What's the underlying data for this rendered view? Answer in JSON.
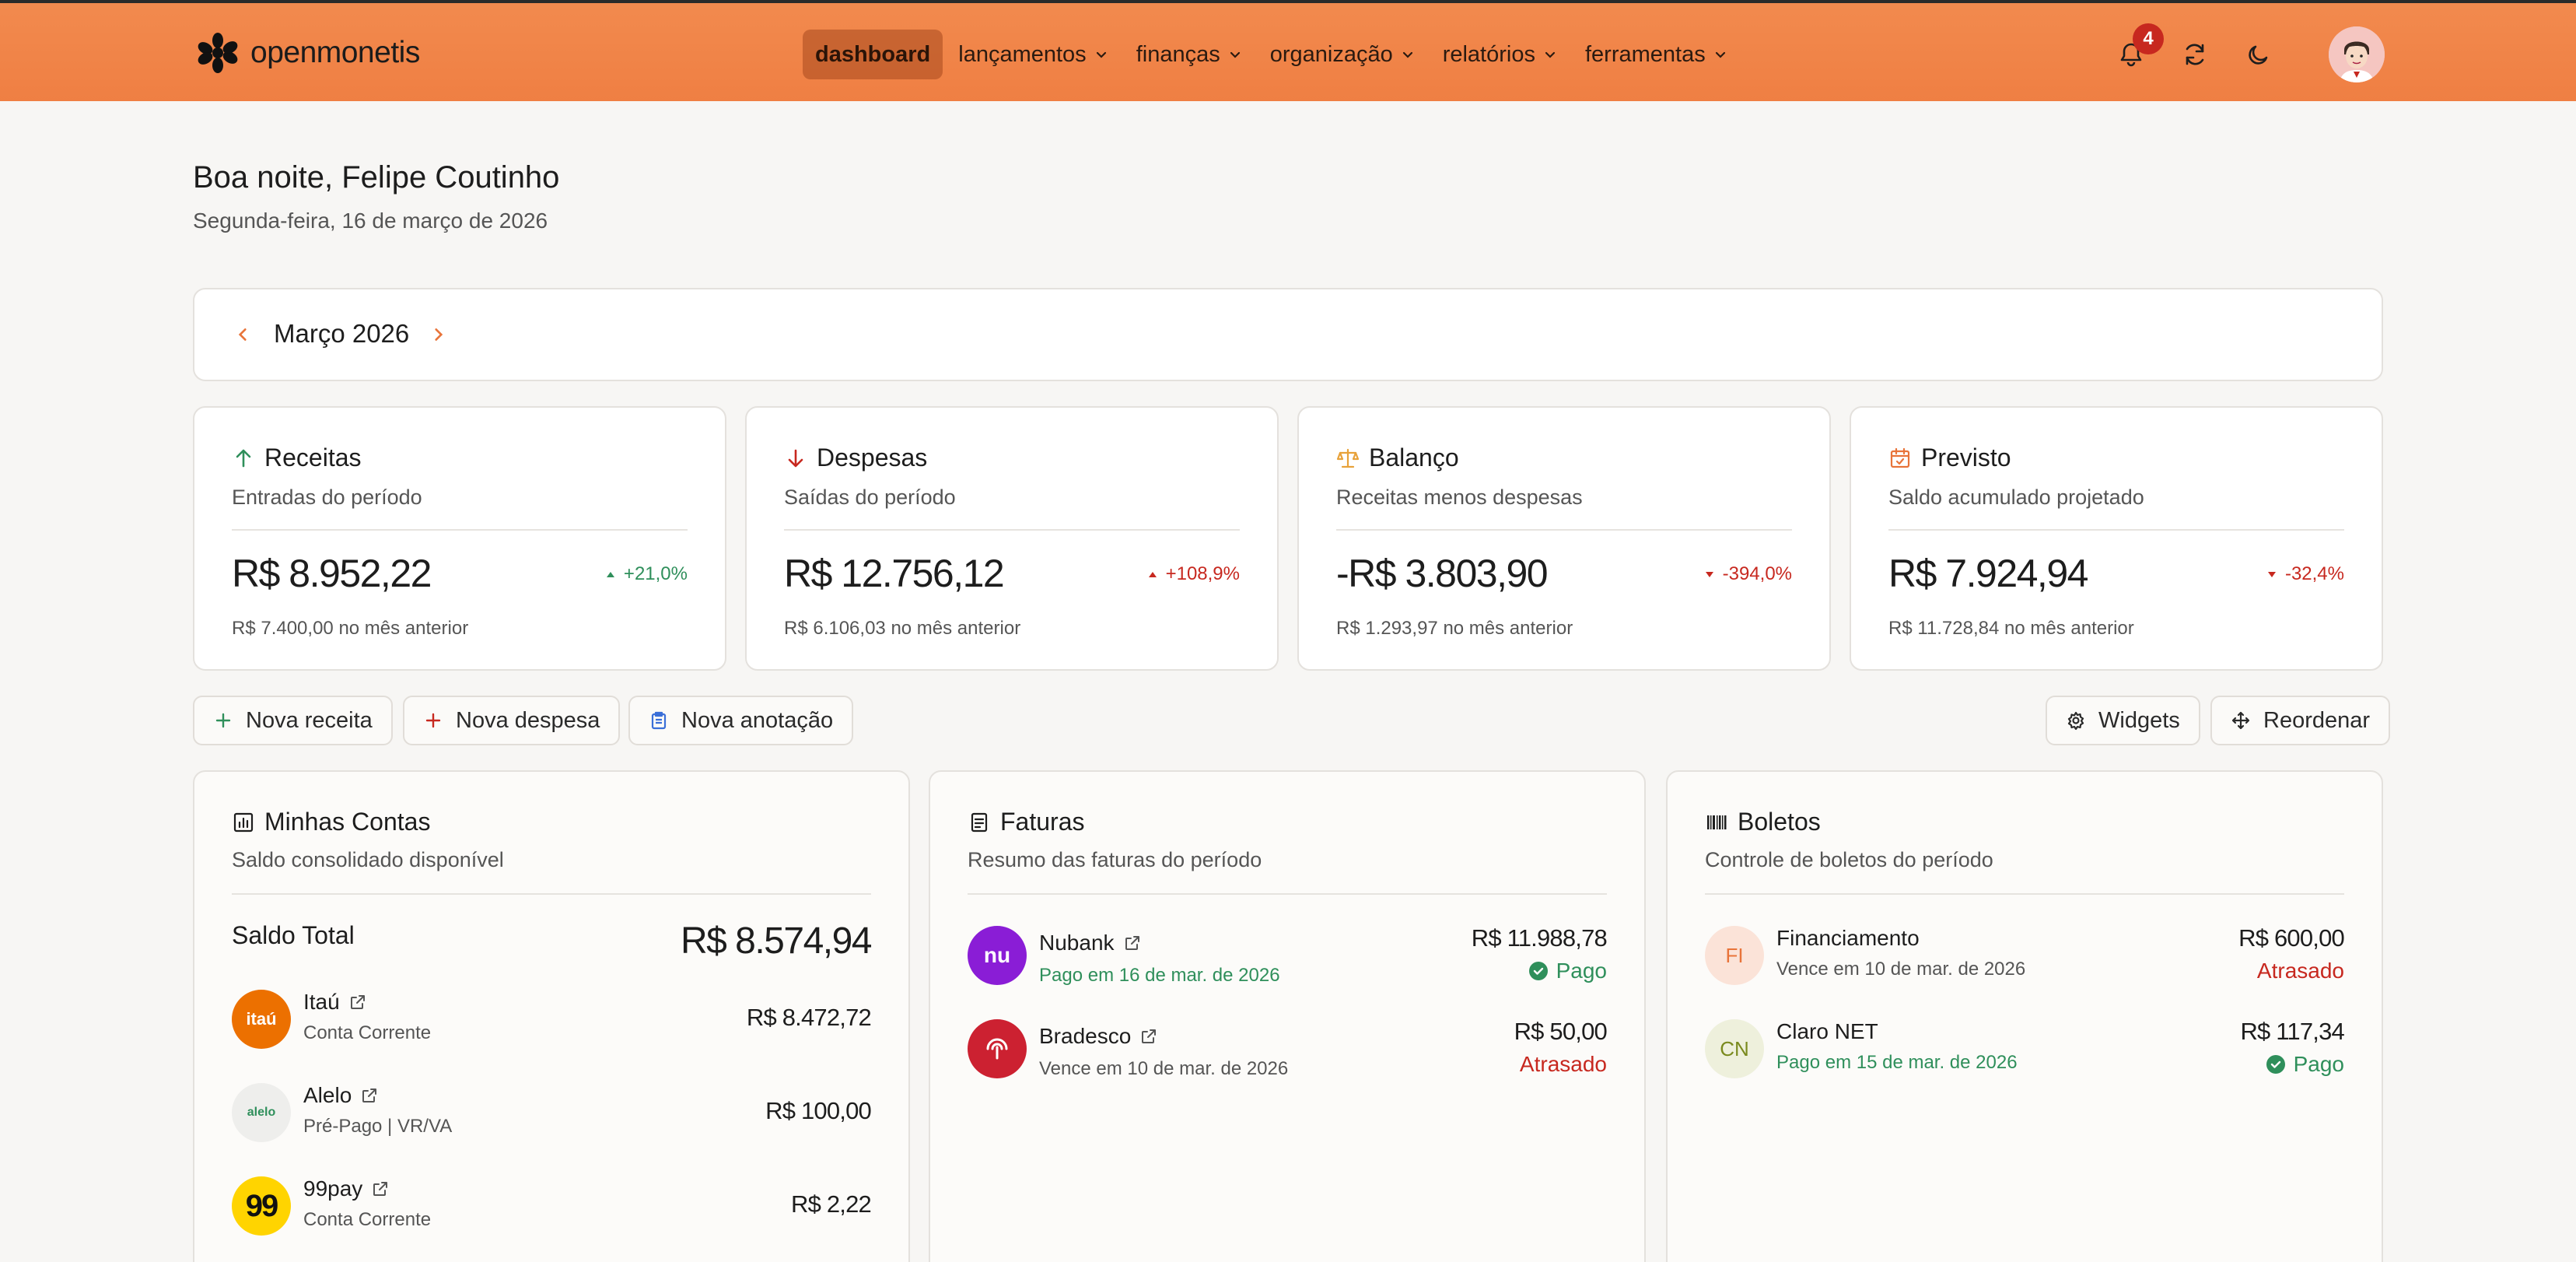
{
  "brand": {
    "name": "openmonetis"
  },
  "nav": {
    "items": [
      {
        "label": "dashboard",
        "active": true,
        "dropdown": false
      },
      {
        "label": "lançamentos",
        "active": false,
        "dropdown": true
      },
      {
        "label": "finanças",
        "active": false,
        "dropdown": true
      },
      {
        "label": "organização",
        "active": false,
        "dropdown": true
      },
      {
        "label": "relatórios",
        "active": false,
        "dropdown": true
      },
      {
        "label": "ferramentas",
        "active": false,
        "dropdown": true
      }
    ],
    "notifications_count": "4",
    "icons": [
      "bell-icon",
      "sync-icon",
      "moon-icon",
      "avatar"
    ]
  },
  "greeting": {
    "title": "Boa noite, Felipe Coutinho",
    "date": "Segunda-feira, 16 de março de 2026"
  },
  "period": {
    "label": "Março 2026"
  },
  "stats": [
    {
      "title": "Receitas",
      "subtitle": "Entradas do período",
      "value": "R$ 8.952,22",
      "change": "+21,0%",
      "previous": "R$ 7.400,00 no mês anterior",
      "icon": "arrow-up-icon",
      "trend": "up",
      "color": "#2f8f5b"
    },
    {
      "title": "Despesas",
      "subtitle": "Saídas do período",
      "value": "R$ 12.756,12",
      "change": "+108,9%",
      "previous": "R$ 6.106,03 no mês anterior",
      "icon": "arrow-down-icon",
      "trend": "up",
      "color": "#c7281f"
    },
    {
      "title": "Balanço",
      "subtitle": "Receitas menos despesas",
      "value": "-R$ 3.803,90",
      "change": "-394,0%",
      "previous": "R$ 1.293,97 no mês anterior",
      "icon": "scale-icon",
      "trend": "down",
      "color": "#c7281f"
    },
    {
      "title": "Previsto",
      "subtitle": "Saldo acumulado projetado",
      "value": "R$ 7.924,94",
      "change": "-32,4%",
      "previous": "R$ 11.728,84 no mês anterior",
      "icon": "calendar-check-icon",
      "trend": "down",
      "color": "#c7281f"
    }
  ],
  "actions": {
    "new_income": "Nova receita",
    "new_expense": "Nova despesa",
    "new_note": "Nova anotação",
    "widgets": "Widgets",
    "reorder": "Reordenar"
  },
  "accounts": {
    "title": "Minhas Contas",
    "subtitle": "Saldo consolidado disponível",
    "total_label": "Saldo Total",
    "total_value": "R$ 8.574,94",
    "items": [
      {
        "name": "Itaú",
        "type": "Conta Corrente",
        "amount": "R$ 8.472,72",
        "logo_text": "itaú"
      },
      {
        "name": "Alelo",
        "type": "Pré-Pago | VR/VA",
        "amount": "R$ 100,00",
        "logo_text": "alelo"
      },
      {
        "name": "99pay",
        "type": "Conta Corrente",
        "amount": "R$ 2,22",
        "logo_text": "99"
      }
    ]
  },
  "invoices": {
    "title": "Faturas",
    "subtitle": "Resumo das faturas do período",
    "items": [
      {
        "name": "Nubank",
        "meta": "Pago em 16 de mar. de 2026",
        "amount": "R$ 11.988,78",
        "status": "Pago",
        "logo_text": "nu"
      },
      {
        "name": "Bradesco",
        "meta": "Vence em 10 de mar. de 2026",
        "amount": "R$ 50,00",
        "status": "Atrasado"
      }
    ]
  },
  "bills": {
    "title": "Boletos",
    "subtitle": "Controle de boletos do período",
    "items": [
      {
        "name": "Financiamento",
        "meta": "Vence em 10 de mar. de 2026",
        "amount": "R$ 600,00",
        "status": "Atrasado",
        "initials": "FI"
      },
      {
        "name": "Claro NET",
        "meta": "Pago em 15 de mar. de 2026",
        "amount": "R$ 117,34",
        "status": "Pago",
        "initials": "CN"
      }
    ]
  },
  "colors": {
    "navbar": "#ef7f43",
    "accent": "#e8743a",
    "positive": "#2f8f5b",
    "negative": "#c7281f"
  }
}
